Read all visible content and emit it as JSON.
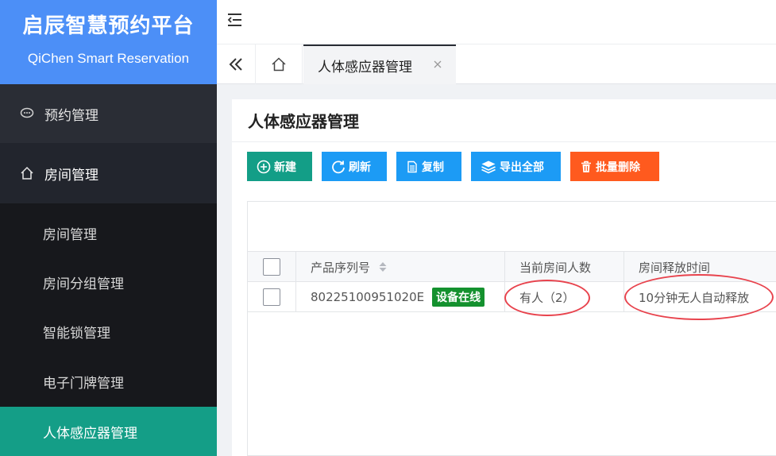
{
  "brand": {
    "title": "启辰智慧预约平台",
    "subtitle": "QiChen Smart Reservation"
  },
  "sidebar": {
    "items": [
      {
        "label": "预约管理",
        "icon": "chat-bubble-icon"
      },
      {
        "label": "房间管理",
        "icon": "home-icon"
      }
    ],
    "subitems": [
      {
        "label": "房间管理"
      },
      {
        "label": "房间分组管理"
      },
      {
        "label": "智能锁管理"
      },
      {
        "label": "电子门牌管理"
      },
      {
        "label": "人体感应器管理",
        "active": true
      }
    ]
  },
  "tabs": {
    "active_label": "人体感应器管理"
  },
  "page": {
    "title": "人体感应器管理"
  },
  "toolbar": {
    "new_label": "新建",
    "refresh_label": "刷新",
    "copy_label": "复制",
    "export_label": "导出全部",
    "delete_label": "批量删除"
  },
  "table": {
    "columns": [
      "产品序列号",
      "当前房间人数",
      "房间释放时间"
    ],
    "rows": [
      {
        "serial": "80225100951020E",
        "status": "设备在线",
        "occupancy": "有人（2）",
        "release": "10分钟无人自动释放"
      }
    ]
  },
  "colors": {
    "brand": "#4c8ff7",
    "active": "#149e87",
    "primary": "#1c9bf5",
    "danger": "#ff5a1e",
    "online": "#14912e",
    "highlight": "#e8434d"
  }
}
